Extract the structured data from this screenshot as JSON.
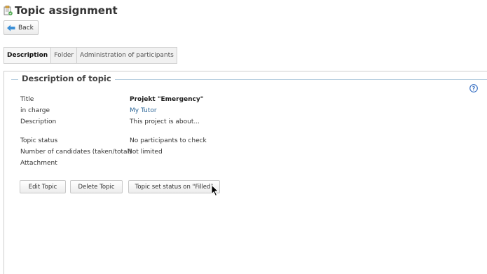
{
  "page": {
    "title": "Topic assignment"
  },
  "toolbar": {
    "back_label": "Back"
  },
  "tabs": [
    {
      "label": "Description",
      "active": true
    },
    {
      "label": "Folder",
      "active": false
    },
    {
      "label": "Administration of participants",
      "active": false
    }
  ],
  "section": {
    "legend": "Description of topic",
    "fields": {
      "title_label": "Title",
      "title_value": "Projekt \"Emergency\"",
      "in_charge_label": "in charge",
      "in_charge_value": "My Tutor",
      "description_label": "Description",
      "description_value": "This project is about...",
      "status_label": "Topic status",
      "status_value": "No participants to check",
      "candidates_label": "Number of candidates (taken/total)",
      "candidates_value": "Not limited",
      "attachment_label": "Attachment",
      "attachment_value": ""
    }
  },
  "actions": {
    "edit_label": "Edit Topic",
    "delete_label": "Delete Topic",
    "set_status_label": "Topic set status on \"Filled\""
  },
  "icons": {
    "title": "topic-assignment-icon",
    "back": "back-arrow-icon",
    "help": "help-icon",
    "cursor": "mouse-pointer-icon"
  },
  "colors": {
    "link": "#2a6496",
    "legend_line": "#b8cfe0",
    "back_arrow": "#3b8fd6",
    "help": "#3b72c4"
  }
}
